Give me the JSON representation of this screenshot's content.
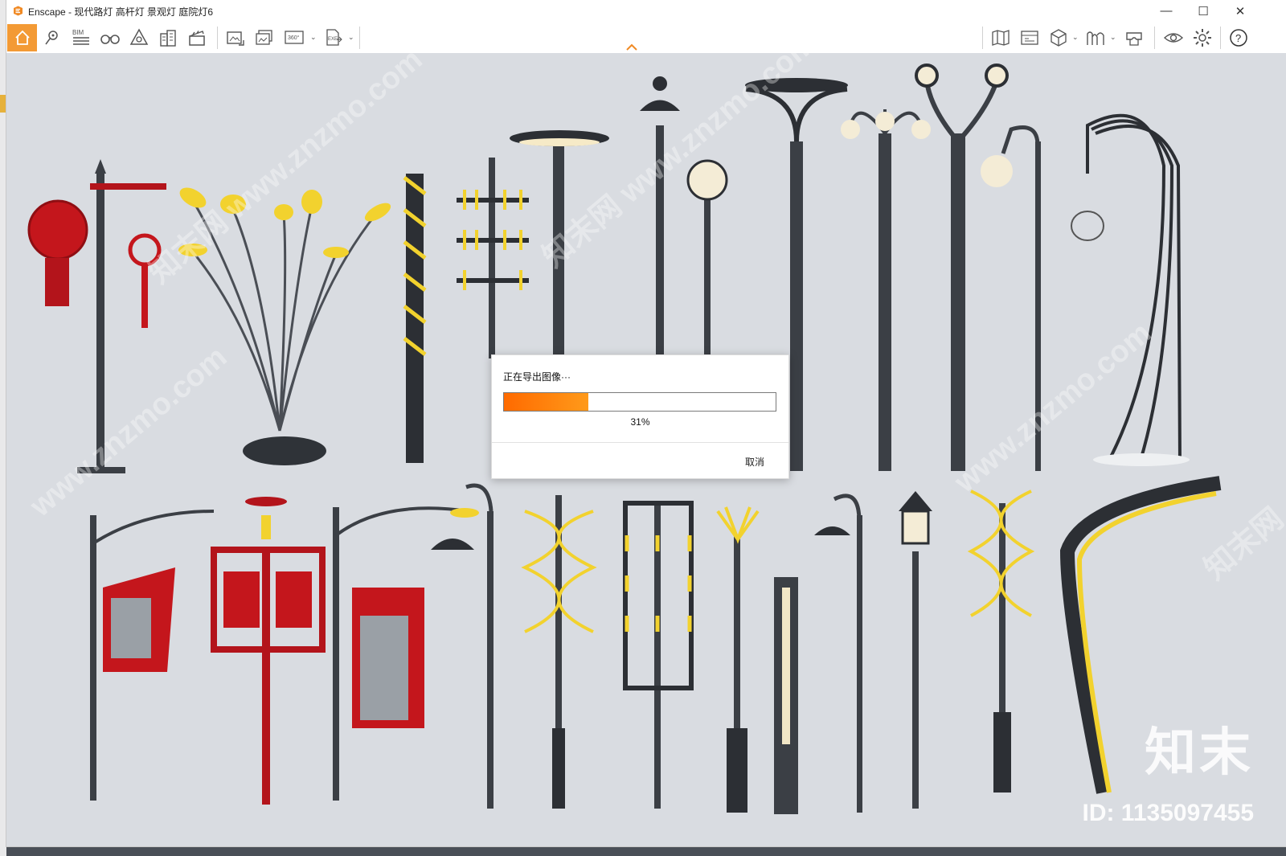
{
  "window": {
    "title": "Enscape - 现代路灯 高杆灯 景观灯 庭院灯6",
    "controls": {
      "minimize": "—",
      "maximize": "☐",
      "close": "✕"
    }
  },
  "toolbar": {
    "left_icons": [
      "home-icon",
      "location-pin-icon",
      "bim-icon",
      "binoculars-icon",
      "asset-library-icon",
      "buildings-icon",
      "clapperboard-icon",
      "screenshot-icon",
      "batch-render-icon",
      "panorama-360-icon",
      "export-exe-icon"
    ],
    "bim_label": "BIM",
    "pano_label": "360°",
    "exe_label": "EXE",
    "right_icons": [
      "map-icon",
      "site-context-icon",
      "cube-icon",
      "materials-icon",
      "vr-headset-icon",
      "visibility-eye-icon",
      "settings-gear-icon",
      "help-icon"
    ],
    "help_label": "?"
  },
  "desktop": {
    "text_1": "▯",
    "text_2": "▯"
  },
  "watermarks": [
    "知末网 www.znzmo.com",
    "www.znzmo.com",
    "知末网 www.znzmo.com",
    "www.znzmo.com",
    "知末网"
  ],
  "brand": {
    "name": "知末",
    "id": "ID: 1135097455"
  },
  "dialog": {
    "title": "正在导出图像···",
    "progress": 0.31,
    "percent_label": "31%",
    "cancel_label": "取消"
  },
  "colors": {
    "accent": "#f39a35",
    "progress_start": "#ff6a00",
    "progress_end": "#ff9a1a",
    "viewport_bg": "#d9dce1",
    "lamp_dark": "#3b3f45",
    "lamp_yellow": "#f2d22e",
    "lamp_red": "#b3141b"
  }
}
